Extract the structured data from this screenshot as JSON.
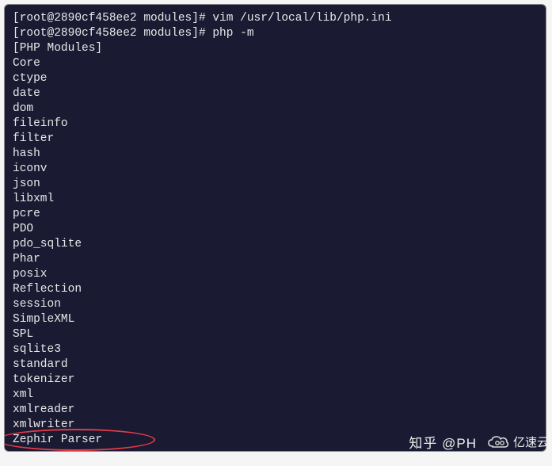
{
  "terminal": {
    "prompt1": "[root@2890cf458ee2 modules]# vim /usr/local/lib/php.ini",
    "prompt2": "[root@2890cf458ee2 modules]# php -m",
    "header": "[PHP Modules]",
    "modules": [
      "Core",
      "ctype",
      "date",
      "dom",
      "fileinfo",
      "filter",
      "hash",
      "iconv",
      "json",
      "libxml",
      "pcre",
      "PDO",
      "pdo_sqlite",
      "Phar",
      "posix",
      "Reflection",
      "session",
      "SimpleXML",
      "SPL",
      "sqlite3",
      "standard",
      "tokenizer",
      "xml",
      "xmlreader",
      "xmlwriter",
      "Zephir Parser"
    ]
  },
  "watermark": {
    "zhihu": "知乎 @PH",
    "yisu": "亿速云"
  }
}
